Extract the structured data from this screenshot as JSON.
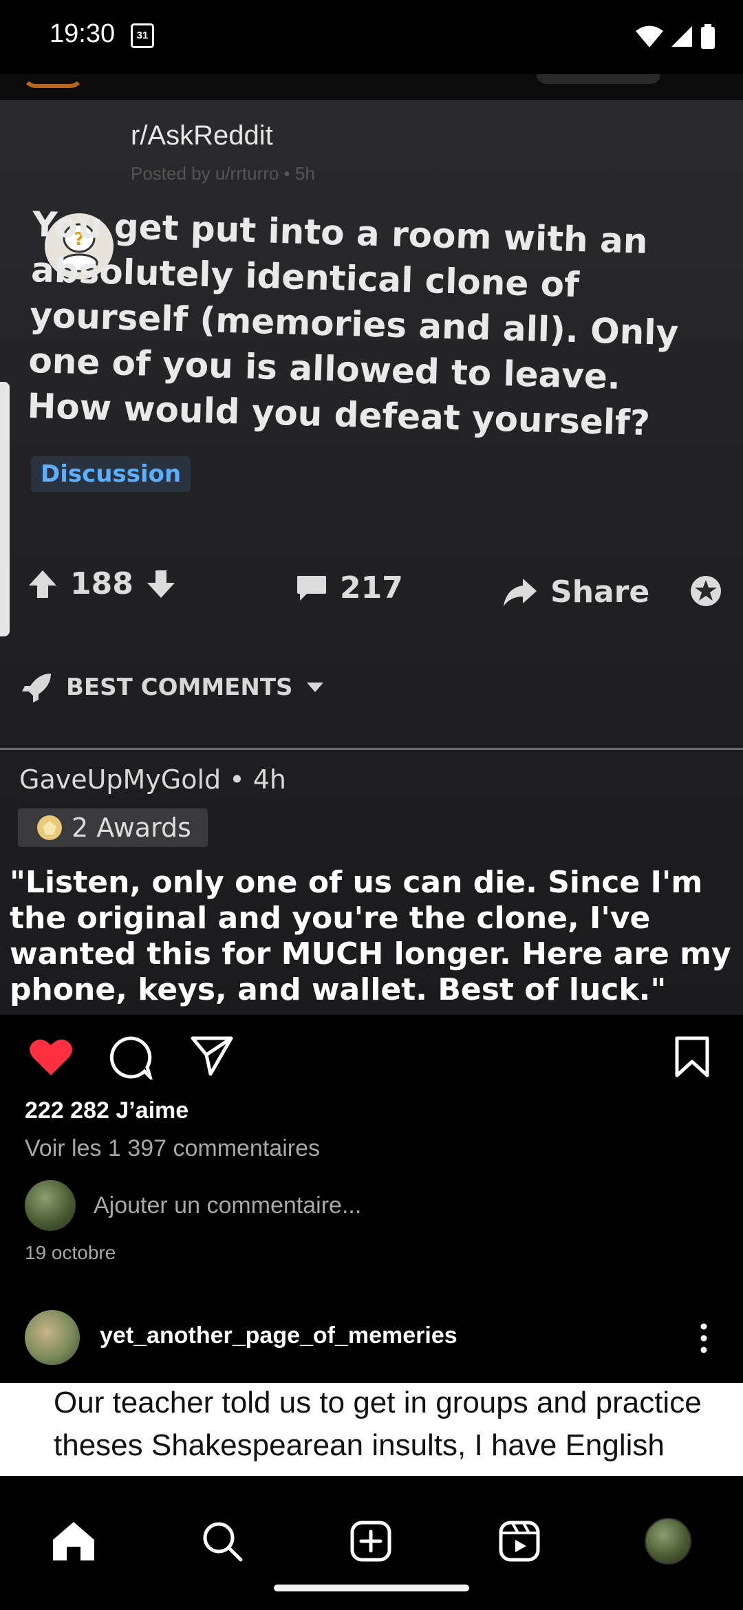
{
  "status_bar": {
    "time": "19:30",
    "calendar_day": "31"
  },
  "post": {
    "screenshot": {
      "subreddit": "r/AskReddit",
      "posted_by": "Posted by u/rrturro • 5h",
      "question": "You get put into a room with an absolutely identical clone of yourself (memories and all). Only one of you is allowed to leave. How would you defeat yourself?",
      "flair": "Discussion",
      "upvotes": "188",
      "comments": "217",
      "share_label": "Share",
      "sort_label": "BEST COMMENTS",
      "comment_author": "GaveUpMyGold • 4h",
      "awards": "2 Awards",
      "comment_text": "\"Listen, only one of us can die. Since I'm the original and you're the clone, I've wanted this for MUCH longer. Here are my phone, keys, and wallet. Best of luck.\""
    },
    "likes": "222 282 J’aime",
    "view_comments": "Voir les 1 397 commentaires",
    "add_comment_placeholder": "Ajouter un commentaire...",
    "date": "19 octobre",
    "liked": true,
    "like_color": "#ff3040"
  },
  "next_post": {
    "username": "yet_another_page_of_memeries",
    "text": "Our teacher told us to get in groups and practice theses Shakespearean insults, I have English what"
  },
  "bottom_nav": {
    "items": [
      "home-icon",
      "search-icon",
      "create-icon",
      "reels-icon",
      "profile-avatar"
    ]
  }
}
